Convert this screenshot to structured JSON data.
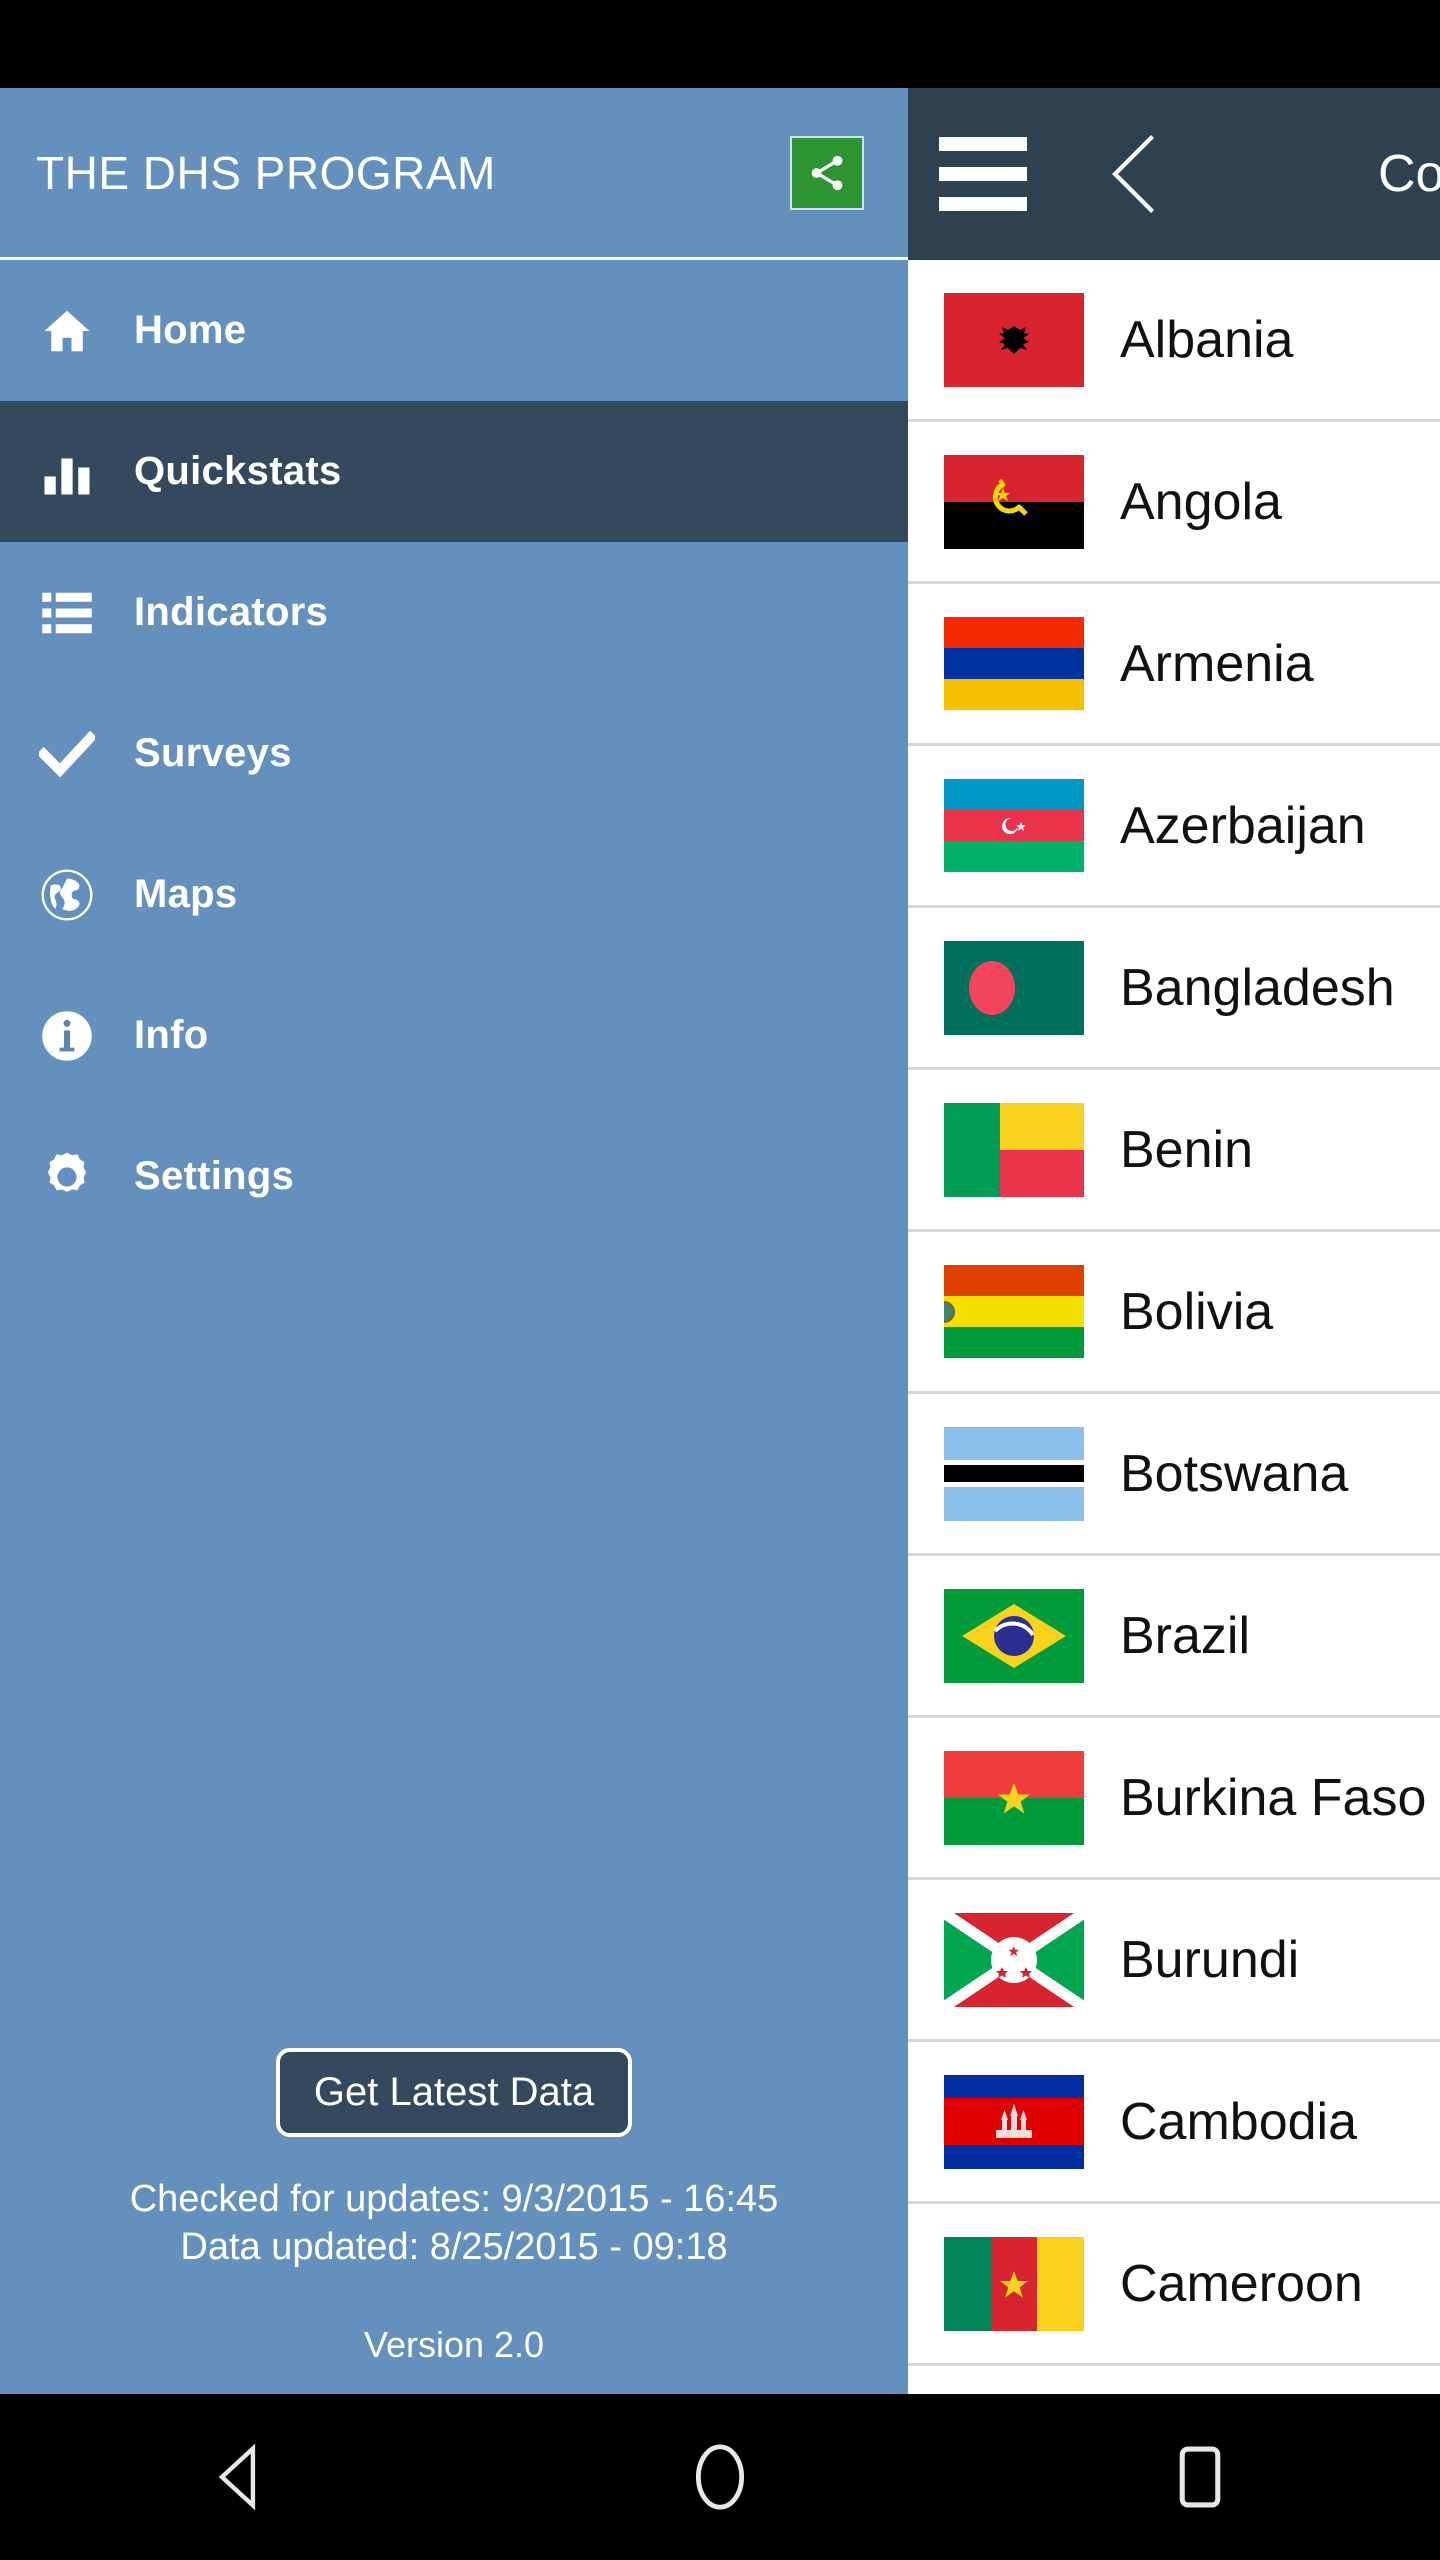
{
  "status_bar": {
    "background": "#000000"
  },
  "drawer": {
    "title": "THE DHS PROGRAM",
    "share_icon": "share-icon",
    "share_color": "#2c9430",
    "background": "#6490bd",
    "active_color": "#34495e",
    "items": [
      {
        "label": "Home",
        "icon": "home-icon",
        "active": false
      },
      {
        "label": "Quickstats",
        "icon": "bar-chart-icon",
        "active": true
      },
      {
        "label": "Indicators",
        "icon": "list-icon",
        "active": false
      },
      {
        "label": "Surveys",
        "icon": "check-icon",
        "active": false
      },
      {
        "label": "Maps",
        "icon": "globe-icon",
        "active": false
      },
      {
        "label": "Info",
        "icon": "info-icon",
        "active": false
      },
      {
        "label": "Settings",
        "icon": "gear-icon",
        "active": false
      }
    ],
    "footer": {
      "get_latest_button": "Get Latest Data",
      "checked_for_updates": "Checked for updates: 9/3/2015 - 16:45",
      "data_updated": "Data updated: 8/25/2015 - 09:18",
      "version": "Version 2.0"
    }
  },
  "content": {
    "appbar": {
      "menu_icon": "hamburger-menu-icon",
      "back_icon": "chevron-left-icon",
      "title": "Countries",
      "background": "#2e4150"
    },
    "countries": [
      {
        "name": "Albania"
      },
      {
        "name": "Angola"
      },
      {
        "name": "Armenia"
      },
      {
        "name": "Azerbaijan"
      },
      {
        "name": "Bangladesh"
      },
      {
        "name": "Benin"
      },
      {
        "name": "Bolivia"
      },
      {
        "name": "Botswana"
      },
      {
        "name": "Brazil"
      },
      {
        "name": "Burkina Faso"
      },
      {
        "name": "Burundi"
      },
      {
        "name": "Cambodia"
      },
      {
        "name": "Cameroon"
      }
    ]
  },
  "navbar": {
    "back_label": "back-button",
    "home_label": "home-button",
    "recents_label": "recents-button"
  }
}
